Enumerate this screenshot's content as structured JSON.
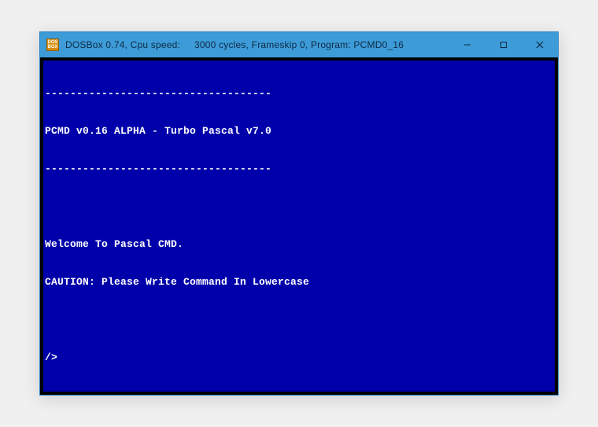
{
  "window": {
    "icon_text": "DOSBOX",
    "title_left": "DOSBox 0.74, Cpu speed:",
    "title_right": "3000 cycles, Frameskip  0, Program: PCMD0_16"
  },
  "terminal": {
    "divider": "------------------------------------",
    "header": "PCMD v0.16 ALPHA - Turbo Pascal v7.0",
    "welcome": "Welcome To Pascal CMD.",
    "caution": "CAUTION: Please Write Command In Lowercase",
    "prompt": "/>"
  },
  "colors": {
    "titlebar_bg": "#3d9bd8",
    "terminal_bg": "#0000aa",
    "terminal_fg": "#ffffff",
    "frame_bg": "#000000"
  }
}
